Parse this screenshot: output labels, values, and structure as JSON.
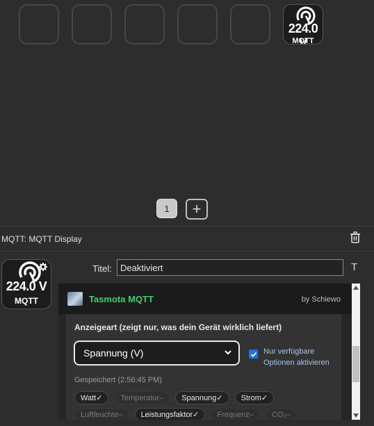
{
  "keys": [
    {
      "state": "empty"
    },
    {
      "state": "empty"
    },
    {
      "state": "empty"
    },
    {
      "state": "empty"
    },
    {
      "state": "empty"
    },
    {
      "state": "active",
      "value": "224.0 V",
      "label": "MQTT",
      "icon": "gauge-icon"
    }
  ],
  "pages": {
    "current": "1",
    "add_label": "+"
  },
  "action": {
    "label_prefix": "MQTT:",
    "name": "MQTT Display"
  },
  "preview": {
    "value": "224.0 V",
    "label": "MQTT"
  },
  "title_field": {
    "label": "Titel:",
    "value": "Deaktiviert"
  },
  "plugin": {
    "name": "Tasmota MQTT",
    "author": "by Schiewo",
    "display_heading": "Anzeigeart (zeigt nur, was dein Gerät wirklich liefert)",
    "selected_option": "Spannung (V)",
    "checkbox_label_line1": "Nur verfügbare",
    "checkbox_label_line2": "Optionen aktivieren",
    "checkbox_checked": true,
    "saved_text": "Gespeichert (2:56:45 PM)",
    "chips_row1": [
      {
        "label": "Watt✓",
        "available": true
      },
      {
        "label": "Temperatur–",
        "available": false
      },
      {
        "label": "Spannung✓",
        "available": true
      },
      {
        "label": "Strom✓",
        "available": true
      }
    ],
    "chips_row2": [
      {
        "label": "Luftfeuchte–",
        "available": false
      },
      {
        "label": "Leistungsfaktor✓",
        "available": true
      },
      {
        "label": "Frequenz–",
        "available": false
      },
      {
        "label": "CO₂–",
        "available": false
      }
    ]
  },
  "colors": {
    "accent_green": "#3ecf6e",
    "checkbox_blue": "#1a73e8",
    "background": "#2d2d2d"
  }
}
